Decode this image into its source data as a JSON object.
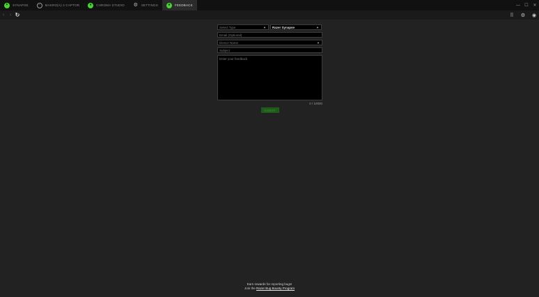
{
  "tabs": [
    {
      "label": "SYNAPSE",
      "icon": "razer-logo-icon",
      "active": false
    },
    {
      "label": "MAKRO(A) 2 CAPTOR",
      "icon": "device-icon",
      "active": false
    },
    {
      "label": "CHROMA STUDIO",
      "icon": "chroma-icon",
      "active": false
    },
    {
      "label": "SETTINGS",
      "icon": "gear-icon",
      "active": false
    },
    {
      "label": "FEEDBACK",
      "icon": "feedback-icon",
      "active": true
    }
  ],
  "window": {
    "minimize": "—",
    "maximize": "☐",
    "close": "✕"
  },
  "toolbar": {
    "back": "‹",
    "forward": "›",
    "reload": "↻"
  },
  "form": {
    "select_type_placeholder": "Select Type",
    "product_selected": "Razer Synapse",
    "email_placeholder": "Email (Optional)",
    "device_placeholder": "Device Name",
    "subject_placeholder": "Subject",
    "feedback_placeholder": "Enter your feedback",
    "counter": "0 / 10000",
    "submit_label": "SUBMIT"
  },
  "footer": {
    "line1": "Earn rewards for reporting bugs!",
    "join_prefix": "Join the ",
    "link_label": "Razer Bug Bounty Program"
  },
  "colors": {
    "accent": "#44d62c",
    "background": "#222222"
  }
}
